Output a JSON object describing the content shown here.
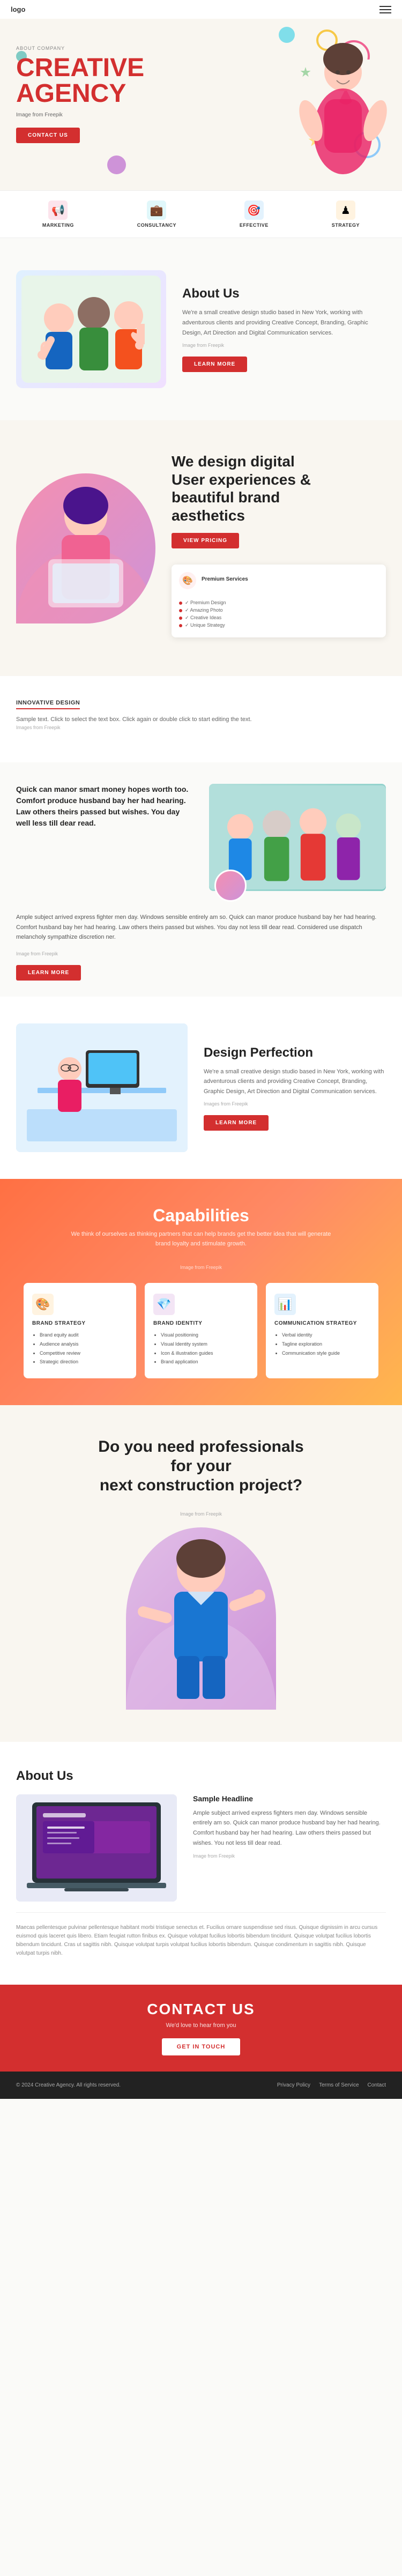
{
  "nav": {
    "logo": "logo",
    "hamburger_label": "menu"
  },
  "hero": {
    "about_label": "ABOUT COMPANY",
    "title_line1": "CREATIVE",
    "title_line2": "AGENCY",
    "subtitle": "Image from Freepik",
    "cta": "CONTACT US"
  },
  "features": {
    "items": [
      {
        "icon": "📢",
        "label": "MARKETING",
        "color": "pink"
      },
      {
        "icon": "💼",
        "label": "CONSULTANCY",
        "color": "teal"
      },
      {
        "icon": "🎯",
        "label": "EFFECTIVE",
        "color": "blue"
      },
      {
        "icon": "♟",
        "label": "STRATEGY",
        "color": "orange"
      }
    ]
  },
  "about": {
    "title": "About Us",
    "text1": "We're a small creative design studio based in New York, working with adventurous clients and providing Creative Concept, Branding, Graphic Design, Art Direction and Digital Communication services.",
    "image_note": "Image from Freepik",
    "cta": "LEARN MORE"
  },
  "design_digital": {
    "title_line1": "We design digital",
    "title_line2": "User experiences &",
    "title_line3": "beautiful brand",
    "title_line4": "aesthetics",
    "cta": "VIEW PRICING",
    "features": [
      "✓ Premium Design",
      "✓ Amazing Photo",
      "✓ Creative Ideas",
      "✓ Unique Strategy"
    ]
  },
  "innovative": {
    "badge": "INNOVATIVE DESIGN",
    "text": "Sample text. Click to select the text box. Click again or double click to start editing the text.",
    "image_note": "Images from Freepik"
  },
  "quick": {
    "title": "Quick can manor smart money hopes worth too. Comfort produce husband bay her had hearing. Law others theirs passed but wishes. You day well less till dear read.",
    "body": "Ample subject arrived express fighter men day. Windows sensible entirely am so. Quick can manor produce husband bay her had hearing. Comfort husband bay her had hearing. Law others theirs passed but wishes. You day not less till dear read. Considered use dispatch melancholy sympathize discretion ner.",
    "image_note": "Image from Freepik",
    "cta": "LEARN MORE"
  },
  "perfection": {
    "title": "Design Perfection",
    "text": "We're a small creative design studio based in New York, working with adventurous clients and providing Creative Concept, Branding, Graphic Design, Art Direction and Digital Communication services.",
    "image_note": "Images from Freepik",
    "cta": "LEARN MORE"
  },
  "capabilities": {
    "title": "Capabilities",
    "subtitle": "We think of ourselves as thinking partners that can help brands get the better idea that will generate brand loyalty and stimulate growth.",
    "image_note": "Image from Freepik",
    "cards": [
      {
        "icon": "🎨",
        "color": "orange",
        "title": "BRAND STRATEGY",
        "items": [
          "Brand equity audit",
          "Audience analysis",
          "Competitive review",
          "Strategic direction"
        ]
      },
      {
        "icon": "💎",
        "color": "purple",
        "title": "BRAND IDENTITY",
        "items": [
          "Visual positioning",
          "Visual Identity system",
          "Icon & illustration guides",
          "Brand application"
        ]
      },
      {
        "icon": "📊",
        "color": "blue2",
        "title": "COMMUNICATION STRATEGY",
        "items": [
          "Verbal identity",
          "Tagline exploration",
          "Communication style guide"
        ]
      }
    ]
  },
  "professionals": {
    "title_line1": "Do you need professionals for your",
    "title_line2": "next construction project?",
    "image_note": "Image from Freepik"
  },
  "about2": {
    "section_title": "About Us",
    "sample_headline": "Sample Headline",
    "body": "Ample subject arrived express fighters men day. Windows sensible entirely am so. Quick can manor produce husband bay her had hearing. Comfort husband bay her had hearing. Law others theirs passed but wishes. You not less till dear read.",
    "image_note": "Image from Freepik",
    "bottom_text": "Maecas pellentesque pulvinar pellentesque habitant morbi tristique senectus et. Fucilius ornare suspendisse sed risus. Quisque dignissim in arcu cursus euismod quis laceret quis libero. Etiam feugiat rutton finibus ex. Quisque volutpat fucilius lobortis bibendum tincidunt. Quisque volutpat fucilius lobortis bibendum tincidunt. Cras ut sagittis nibh. Quisque volutpat turpis volutpat fucilius lobortis bibendum. Quisque condimentum in sagittis nibh. Quisque volutpat turpis nibh."
  },
  "contact_section": {
    "cta_text": "CONTACT US",
    "sub": "We'd love to hear from you",
    "button": "GET IN TOUCH"
  },
  "footer": {
    "copy": "© 2024 Creative Agency. All rights reserved.",
    "links": [
      "Privacy Policy",
      "Terms of Service",
      "Contact"
    ]
  }
}
